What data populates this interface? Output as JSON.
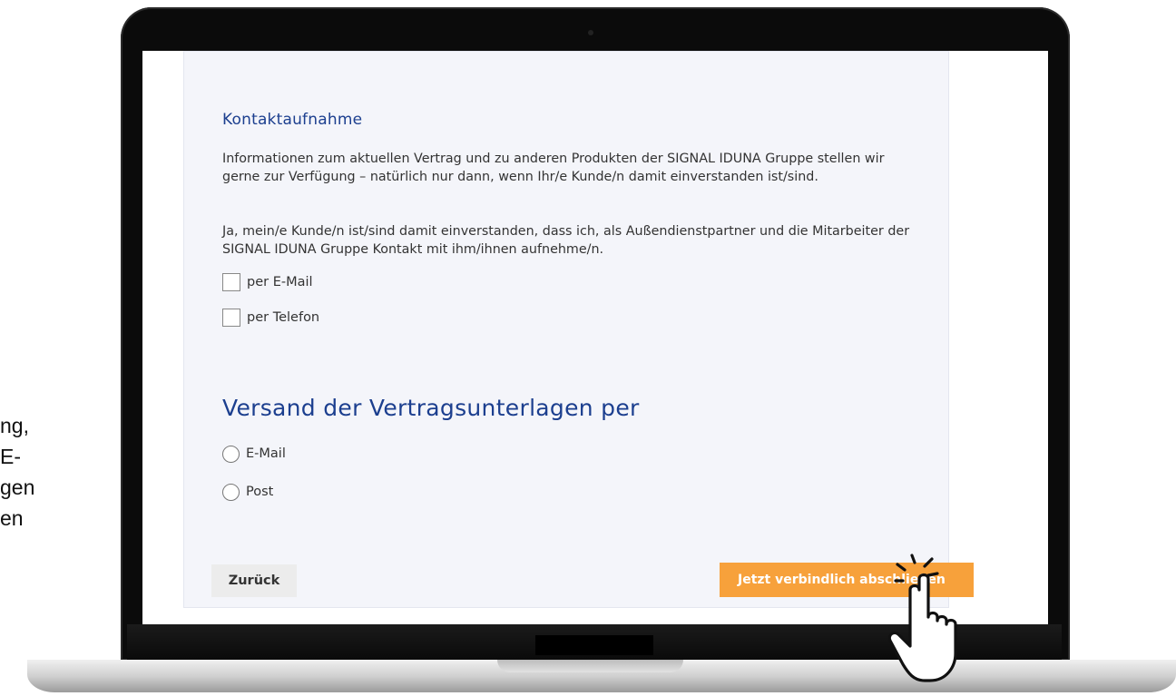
{
  "side_caption": {
    "line1": "ng,",
    "line2": "E-",
    "line3": "gen",
    "line4": "en"
  },
  "contact": {
    "title": "Kontaktaufnahme",
    "paragraph1": "Informationen zum aktuellen Vertrag und zu anderen Produkten der SIGNAL IDUNA Gruppe stellen wir gerne zur Verfügung – natürlich nur dann, wenn Ihr/e Kunde/n damit einverstanden ist/sind.",
    "paragraph2": "Ja, mein/e Kunde/n ist/sind damit einverstanden, dass ich, als Außendienstpartner und die Mitarbeiter der SIGNAL IDUNA Gruppe Kontakt mit ihm/ihnen aufnehme/n.",
    "options": [
      {
        "label": "per E-Mail",
        "checked": false
      },
      {
        "label": "per Telefon",
        "checked": false
      }
    ]
  },
  "shipping": {
    "title": "Versand der Vertragsunterlagen per",
    "options": [
      {
        "label": "E-Mail",
        "selected": false
      },
      {
        "label": "Post",
        "selected": false
      }
    ]
  },
  "buttons": {
    "back_label": "Zurück",
    "submit_label": "Jetzt verbindlich abschließen"
  },
  "colors": {
    "heading": "#1c3f8f",
    "submit": "#f7a13b",
    "panel": "#f4f5fa"
  },
  "icons": {
    "cursor": "hand-pointer-icon"
  }
}
